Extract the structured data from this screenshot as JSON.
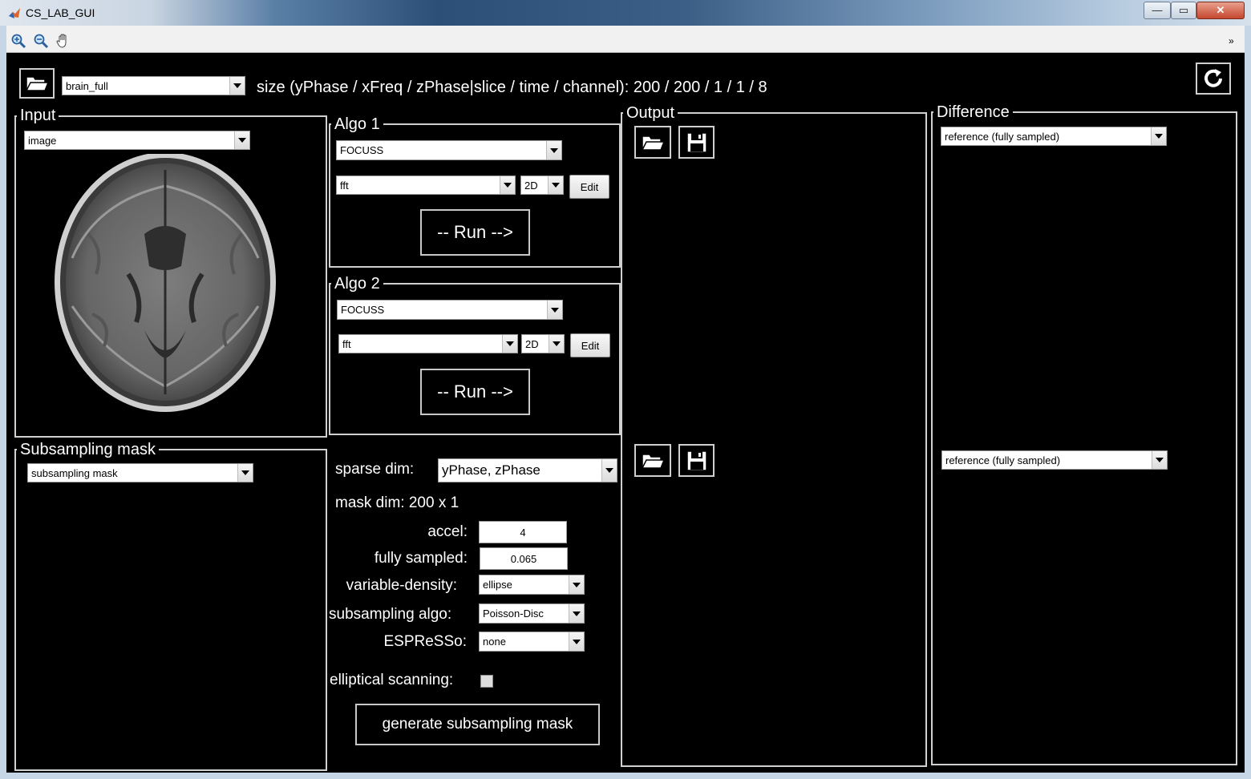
{
  "window": {
    "title": "CS_LAB_GUI",
    "minimize": "—",
    "maximize": "▭",
    "close": "✕"
  },
  "toolbar": {
    "zoom_in": "zoom-in-icon",
    "zoom_out": "zoom-out-icon",
    "pan": "pan-hand-icon",
    "more": "»"
  },
  "header": {
    "dataset": "brain_full",
    "size_text": "size (yPhase / xFreq / zPhase|slice / time / channel): 200 / 200 / 1 / 1 / 8"
  },
  "input_panel": {
    "title": "Input",
    "view": "image"
  },
  "mask_panel": {
    "title": "Subsampling mask",
    "view": "subsampling mask"
  },
  "algo1": {
    "title": "Algo 1",
    "method": "FOCUSS",
    "transform": "fft",
    "dim": "2D",
    "edit": "Edit",
    "run": "-- Run -->"
  },
  "algo2": {
    "title": "Algo 2",
    "method": "FOCUSS",
    "transform": "fft",
    "dim": "2D",
    "edit": "Edit",
    "run": "-- Run -->"
  },
  "mask_settings": {
    "sparse_dim_label": "sparse dim:",
    "sparse_dim": "yPhase, zPhase",
    "mask_dim_text": "mask dim: 200 x 1",
    "accel_label": "accel:",
    "accel": "4",
    "fully_sampled_label": "fully sampled:",
    "fully_sampled": "0.065",
    "variable_density_label": "variable-density:",
    "variable_density": "ellipse",
    "subsampling_algo_label": "subsampling algo:",
    "subsampling_algo": "Poisson-Disc",
    "espresso_label": "ESPReSSo:",
    "espresso": "none",
    "elliptical_label": "elliptical scanning:",
    "generate": "generate subsampling mask"
  },
  "output_panel": {
    "title": "Output"
  },
  "difference_panel": {
    "title": "Difference",
    "ref1": "reference (fully sampled)",
    "ref2": "reference (fully sampled)"
  }
}
